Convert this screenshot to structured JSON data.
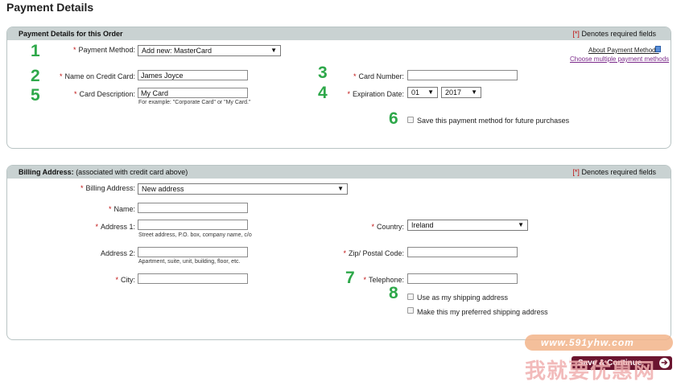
{
  "page_title": "Payment Details",
  "payment": {
    "header_title": "Payment Details for this Order",
    "req_bracket": "[*]",
    "req_text": " Denotes required fields",
    "payment_method_label": "Payment Method:",
    "payment_method_value": "Add new: MasterCard",
    "about_link": "About Payment Methods",
    "choose_multiple_link": "Choose multiple payment methods",
    "name_label": "Name on Credit Card:",
    "name_value": "James Joyce",
    "card_number_label": "Card Number:",
    "card_number_value": "",
    "description_label": "Card Description:",
    "description_value": "My Card",
    "description_hint": "For example: \"Corporate Card\" or \"My Card.\"",
    "expiration_label": "Expiration Date:",
    "exp_month": "01",
    "exp_year": "2017",
    "save_method_label": "Save this payment method for future purchases"
  },
  "billing": {
    "header_title_bold": "Billing Address:",
    "header_title_rest": " (associated with credit card above)",
    "req_bracket": "[*]",
    "req_text": " Denotes required fields",
    "billing_address_label": "Billing Address:",
    "billing_address_value": "New address",
    "name_label": "Name:",
    "name_value": "",
    "address1_label": "Address 1:",
    "address1_value": "",
    "address1_hint": "Street address, P.O. box, company name, c/o",
    "address2_label": "Address 2:",
    "address2_value": "",
    "address2_hint": "Apartment, suite, unit, building, floor, etc.",
    "city_label": "City:",
    "city_value": "",
    "country_label": "Country:",
    "country_value": "Ireland",
    "zip_label": "Zip/ Postal Code:",
    "zip_value": "",
    "telephone_label": "Telephone:",
    "telephone_value": "",
    "use_shipping_label": "Use as my shipping address",
    "preferred_shipping_label": "Make this my preferred shipping address"
  },
  "annotations": [
    "1",
    "2",
    "3",
    "4",
    "5",
    "6",
    "7",
    "8"
  ],
  "save_button": "Save & Continue",
  "watermark": {
    "url": "www.591yhw.com",
    "text": "我就要优惠网"
  },
  "icons": {
    "info": "info-icon",
    "dropdown": "chevron-down-icon",
    "continue": "arrow-right-circle-icon"
  }
}
